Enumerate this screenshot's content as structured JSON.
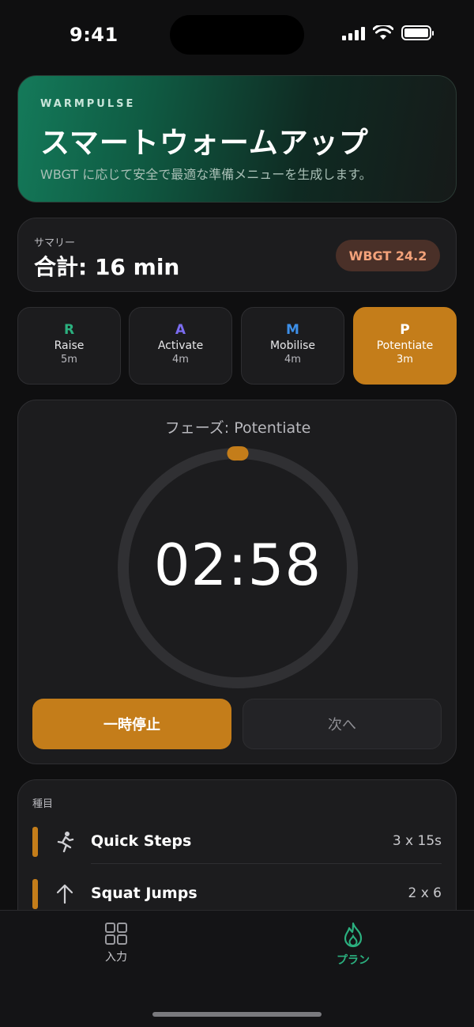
{
  "status": {
    "time": "9:41"
  },
  "hero": {
    "brand": "WARMPULSE",
    "title": "スマートウォームアップ",
    "subtitle": "WBGT に応じて安全で最適な準備メニューを生成します。"
  },
  "summary": {
    "label": "サマリー",
    "total": "合計: 16 min",
    "wbgt": "WBGT 24.2"
  },
  "phases": [
    {
      "letter": "R",
      "name": "Raise",
      "duration": "5m",
      "color": "#2bb07f"
    },
    {
      "letter": "A",
      "name": "Activate",
      "duration": "4m",
      "color": "#7b6cf0"
    },
    {
      "letter": "M",
      "name": "Mobilise",
      "duration": "4m",
      "color": "#3d8fe8"
    },
    {
      "letter": "P",
      "name": "Potentiate",
      "duration": "3m",
      "color": "#ffffff",
      "active": true
    }
  ],
  "timer": {
    "phase_label": "フェーズ: Potentiate",
    "time": "02:58",
    "progress": 0.01,
    "pause_label": "一時停止",
    "next_label": "次へ"
  },
  "exercises": {
    "label": "種目",
    "items": [
      {
        "icon": "running-figure-icon",
        "name": "Quick Steps",
        "sets": "3 x 15s"
      },
      {
        "icon": "arrow-up-icon",
        "name": "Squat Jumps",
        "sets": "2 x 6"
      }
    ]
  },
  "tabs": [
    {
      "icon": "grid-icon",
      "label": "入力",
      "active": false
    },
    {
      "icon": "flame-icon",
      "label": "プラン",
      "active": true
    }
  ],
  "colors": {
    "accent": "#c47d1a",
    "brand_green": "#147a5a",
    "active_tab": "#2bb07f",
    "wbgt_text": "#f3a27a"
  }
}
